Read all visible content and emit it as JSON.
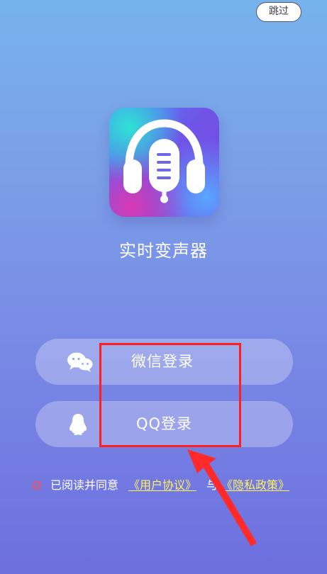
{
  "header": {
    "skip_label": "跳过"
  },
  "app": {
    "name": "实时变声器"
  },
  "login": {
    "wechat_label": "微信登录",
    "qq_label": "QQ登录"
  },
  "agreement": {
    "prefix": "已阅读并同意",
    "user_agreement": "《用户协议》",
    "and": "与",
    "privacy_policy": "《隐私政策》",
    "checked": false
  },
  "icons": {
    "app_logo": "headphones-microphone-icon",
    "wechat": "wechat-icon",
    "qq": "qq-icon",
    "checkbox": "unchecked-circle-icon"
  },
  "colors": {
    "highlight": "#ff1f1f",
    "agreement_link": "#fff25a",
    "button_text": "#ffffff"
  }
}
